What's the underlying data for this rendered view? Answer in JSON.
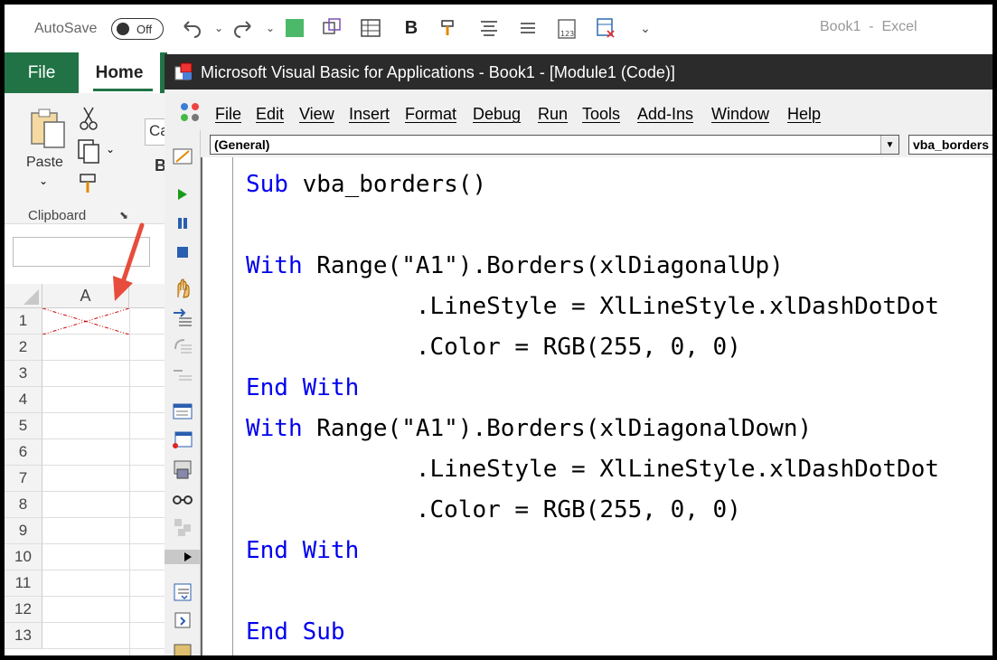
{
  "excel": {
    "autosave_label": "AutoSave",
    "autosave_state": "Off",
    "window_title": "Book1  -  Excel",
    "tabs": {
      "file": "File",
      "home": "Home"
    },
    "ribbon": {
      "paste_label": "Paste",
      "clipboard_group": "Clipboard",
      "font_box_value": "Ca",
      "bold_label": "B"
    },
    "grid": {
      "column_header": "A",
      "rows": [
        "1",
        "2",
        "3",
        "4",
        "5",
        "6",
        "7",
        "8",
        "9",
        "10",
        "11",
        "12",
        "13"
      ],
      "diagonal_color": "#cc0000"
    }
  },
  "vba": {
    "title": "Microsoft Visual Basic for Applications - Book1 - [Module1 (Code)]",
    "menu": [
      "File",
      "Edit",
      "View",
      "Insert",
      "Format",
      "Debug",
      "Run",
      "Tools",
      "Add-Ins",
      "Window",
      "Help"
    ],
    "object_combo": "(General)",
    "procedure_combo": "vba_borders",
    "code": {
      "l1_kw": "Sub",
      "l1_rest": " vba_borders()",
      "l3_kw": "With",
      "l3_rest": " Range(\"A1\").Borders(xlDiagonalUp)",
      "l4": "            .LineStyle = XlLineStyle.xlDashDotDot",
      "l5": "            .Color = RGB(255, 0, 0)",
      "l6_kw": "End With",
      "l7_kw": "With",
      "l7_rest": " Range(\"A1\").Borders(xlDiagonalDown)",
      "l8": "            .LineStyle = XlLineStyle.xlDashDotDot",
      "l9": "            .Color = RGB(255, 0, 0)",
      "l10_kw": "End With",
      "l12_kw": "End Sub"
    },
    "keyword_color": "#0000ee"
  },
  "annotation": {
    "arrow_color": "#e74c3c"
  }
}
